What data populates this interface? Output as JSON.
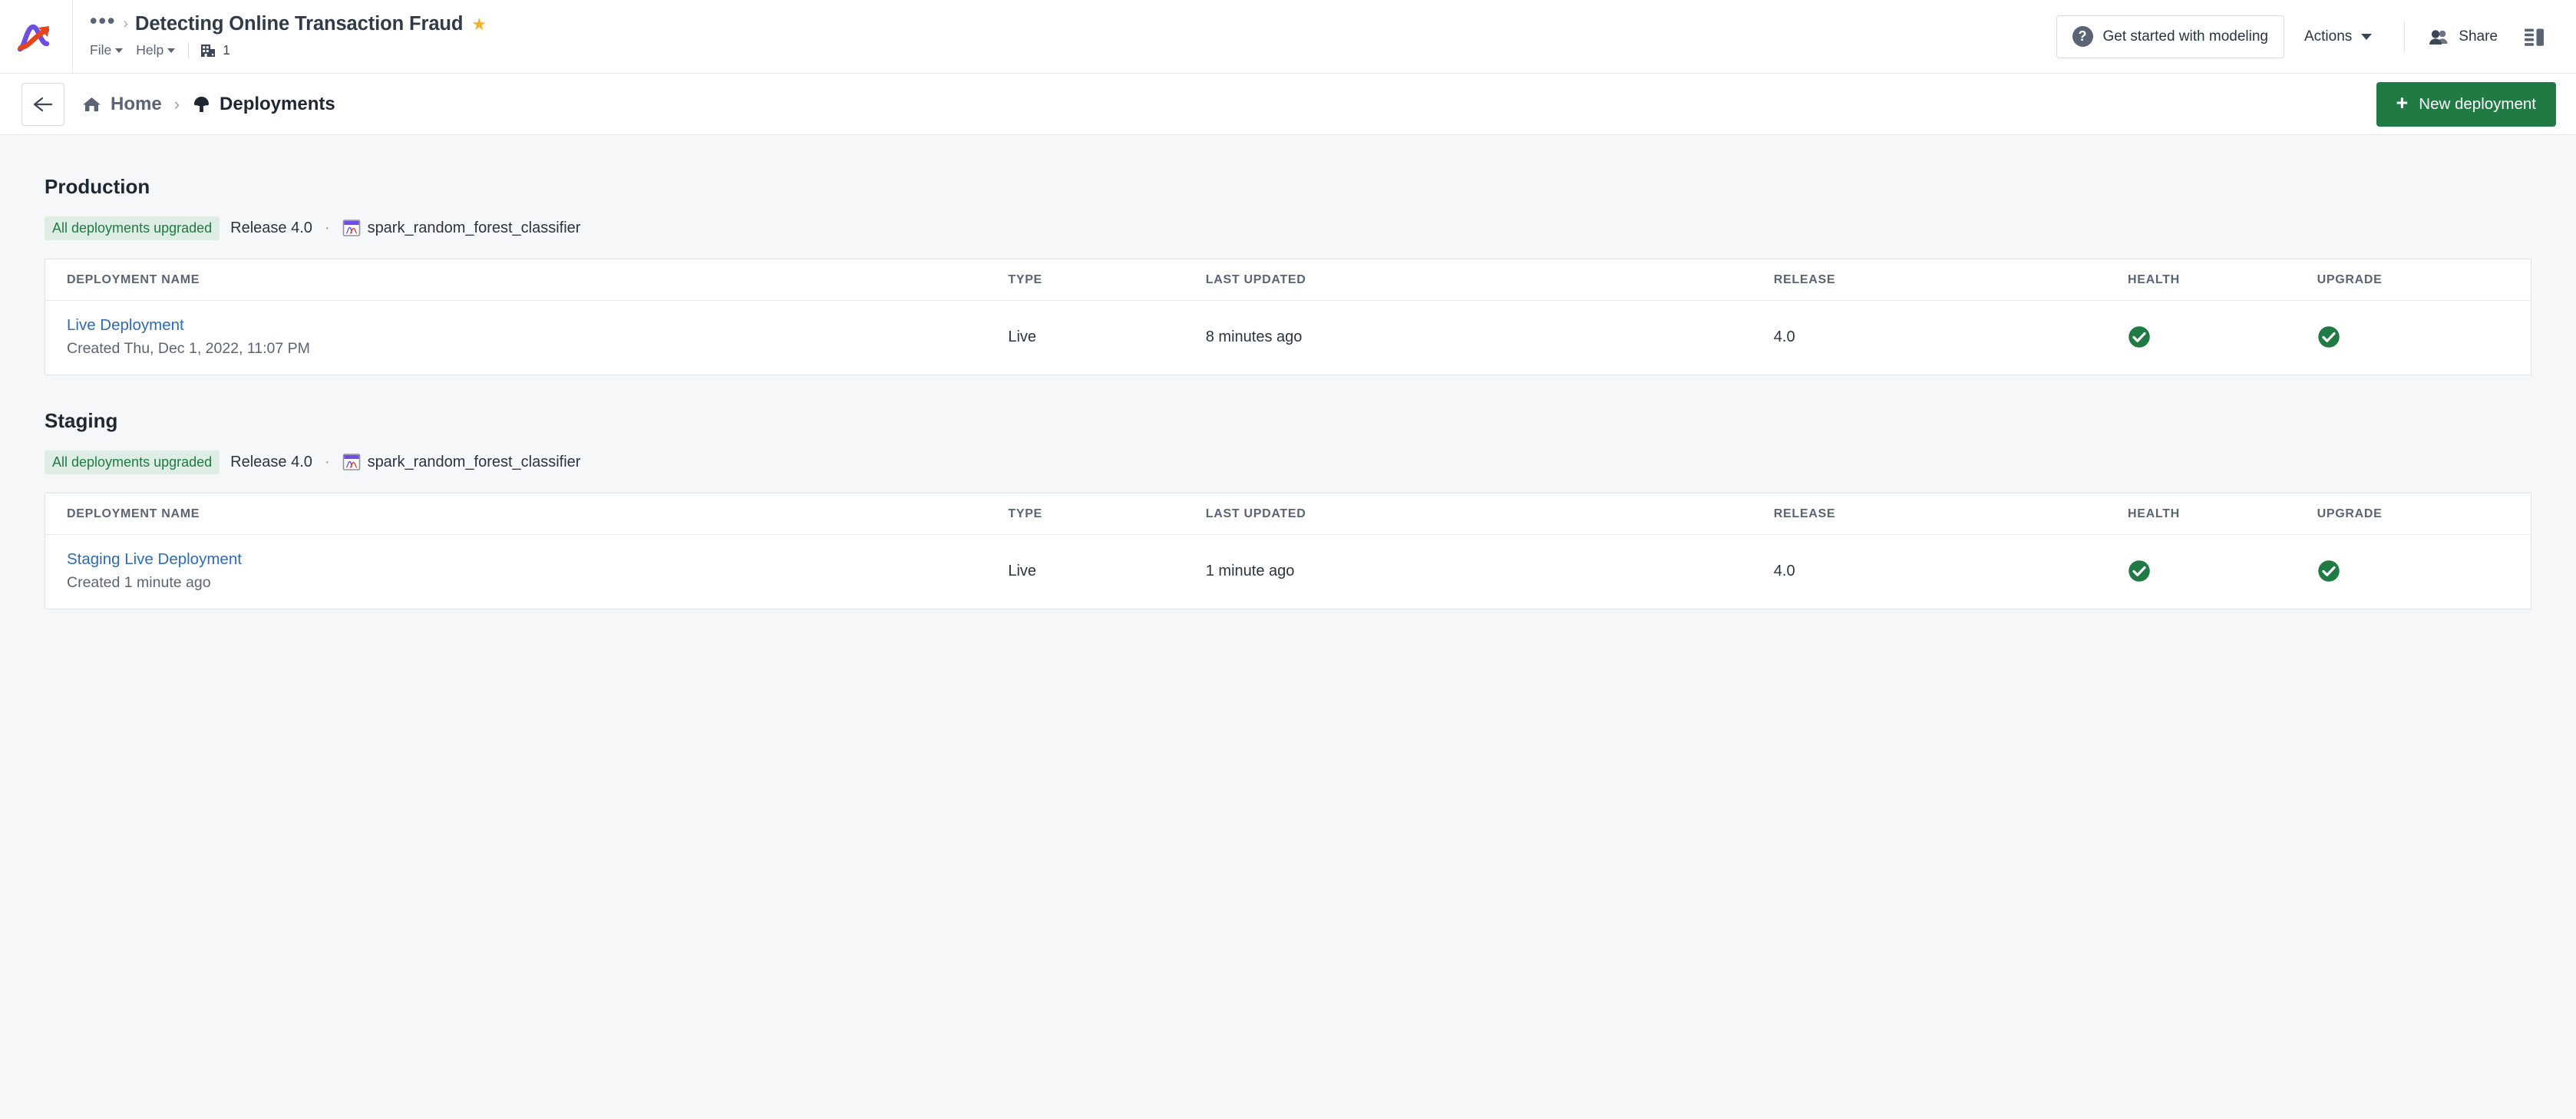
{
  "topbar": {
    "logo_name": "datarobot-logo",
    "breadcrumb_dots": "•••",
    "breadcrumb_sep": "›",
    "project_title": "Detecting Online Transaction Fraud",
    "favorite_star": "★",
    "menus": [
      {
        "label": "File"
      },
      {
        "label": "Help"
      }
    ],
    "org_icon": "building-icon",
    "org_count": "1",
    "get_started_label": "Get started with modeling",
    "help_icon_glyph": "?",
    "actions_label": "Actions",
    "share_label": "Share",
    "share_icon": "users-icon",
    "panel_toggle_icon": "sidebar-panel-icon"
  },
  "subbar": {
    "back_icon": "arrow-left-icon",
    "home_icon": "home-icon",
    "home_label": "Home",
    "separator": "›",
    "deployments_icon": "deployments-upload-icon",
    "deployments_label": "Deployments",
    "new_deployment_label": "New deployment",
    "new_deployment_plus": "+"
  },
  "table_columns": [
    "DEPLOYMENT NAME",
    "TYPE",
    "LAST UPDATED",
    "RELEASE",
    "HEALTH",
    "UPGRADE"
  ],
  "sections": [
    {
      "title": "Production",
      "badge": "All deployments upgraded",
      "release": "Release 4.0",
      "dot": "·",
      "model_icon": "model-window-icon",
      "model_name": "spark_random_forest_classifier",
      "rows": [
        {
          "name": "Live Deployment",
          "created": "Created Thu, Dec 1, 2022, 11:07 PM",
          "type": "Live",
          "last_updated": "8 minutes ago",
          "release": "4.0",
          "health": "healthy-check-icon",
          "upgrade": "healthy-check-icon"
        }
      ]
    },
    {
      "title": "Staging",
      "badge": "All deployments upgraded",
      "release": "Release 4.0",
      "dot": "·",
      "model_icon": "model-window-icon",
      "model_name": "spark_random_forest_classifier",
      "rows": [
        {
          "name": "Staging Live Deployment",
          "created": "Created 1 minute ago",
          "type": "Live",
          "last_updated": "1 minute ago",
          "release": "4.0",
          "health": "healthy-check-icon",
          "upgrade": "healthy-check-icon"
        }
      ]
    }
  ],
  "colors": {
    "accent_green": "#1f7a44",
    "link_blue": "#2d6cb5",
    "badge_bg": "#dfeee4",
    "page_bg": "#f6f7f9",
    "star_yellow": "#f5b324"
  }
}
